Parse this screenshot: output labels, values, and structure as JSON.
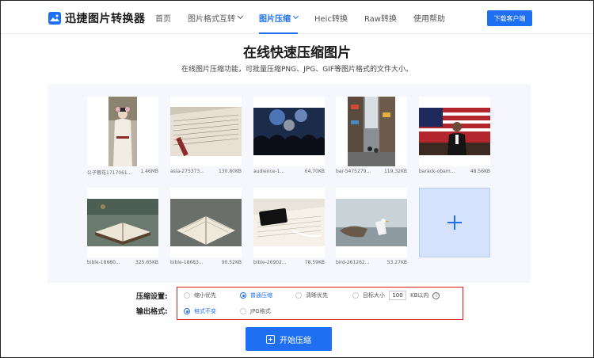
{
  "header": {
    "logo_text": "迅捷图片转换器",
    "nav": [
      {
        "label": "首页",
        "active": false,
        "dropdown": false
      },
      {
        "label": "图片格式互转",
        "active": false,
        "dropdown": true
      },
      {
        "label": "图片压缩",
        "active": true,
        "dropdown": true
      },
      {
        "label": "Heic转换",
        "active": false,
        "dropdown": false
      },
      {
        "label": "Raw转换",
        "active": false,
        "dropdown": false
      },
      {
        "label": "使用帮助",
        "active": false,
        "dropdown": false
      }
    ],
    "download_label": "下载客户端"
  },
  "main": {
    "title": "在线快速压缩图片",
    "subtitle": "在线图片压缩功能，可批量压缩PNG、JPG、GIF等图片格式的文件大小。"
  },
  "images": [
    {
      "name": "公子蓉花1717061...",
      "size": "1.46MB"
    },
    {
      "name": "asia-275373...",
      "size": "130.80KB"
    },
    {
      "name": "audience-1...",
      "size": "64.70KB"
    },
    {
      "name": "bar-5475279...",
      "size": "119.32KB"
    },
    {
      "name": "barack-obam...",
      "size": "48.56KB"
    },
    {
      "name": "bible-18680...",
      "size": "325.65KB"
    },
    {
      "name": "bible-18683...",
      "size": "90.52KB"
    },
    {
      "name": "bible-26902...",
      "size": "78.59KB"
    },
    {
      "name": "bird-261262...",
      "size": "53.27KB"
    }
  ],
  "settings": {
    "compress_label": "压缩设置:",
    "format_label": "输出格式:",
    "compress_options": [
      {
        "label": "缩小优先",
        "selected": false
      },
      {
        "label": "普通压缩",
        "selected": true
      },
      {
        "label": "清晰优先",
        "selected": false
      },
      {
        "label": "目标大小",
        "selected": false
      }
    ],
    "target_size_value": "100",
    "target_size_unit": "KB以内",
    "info_glyph": "i",
    "format_options": [
      {
        "label": "格式不变",
        "selected": true
      },
      {
        "label": "JPG格式",
        "selected": false
      }
    ]
  },
  "start_button": "开始压缩",
  "colors": {
    "accent": "#1f6ff2",
    "highlight_border": "#e21b1b"
  }
}
